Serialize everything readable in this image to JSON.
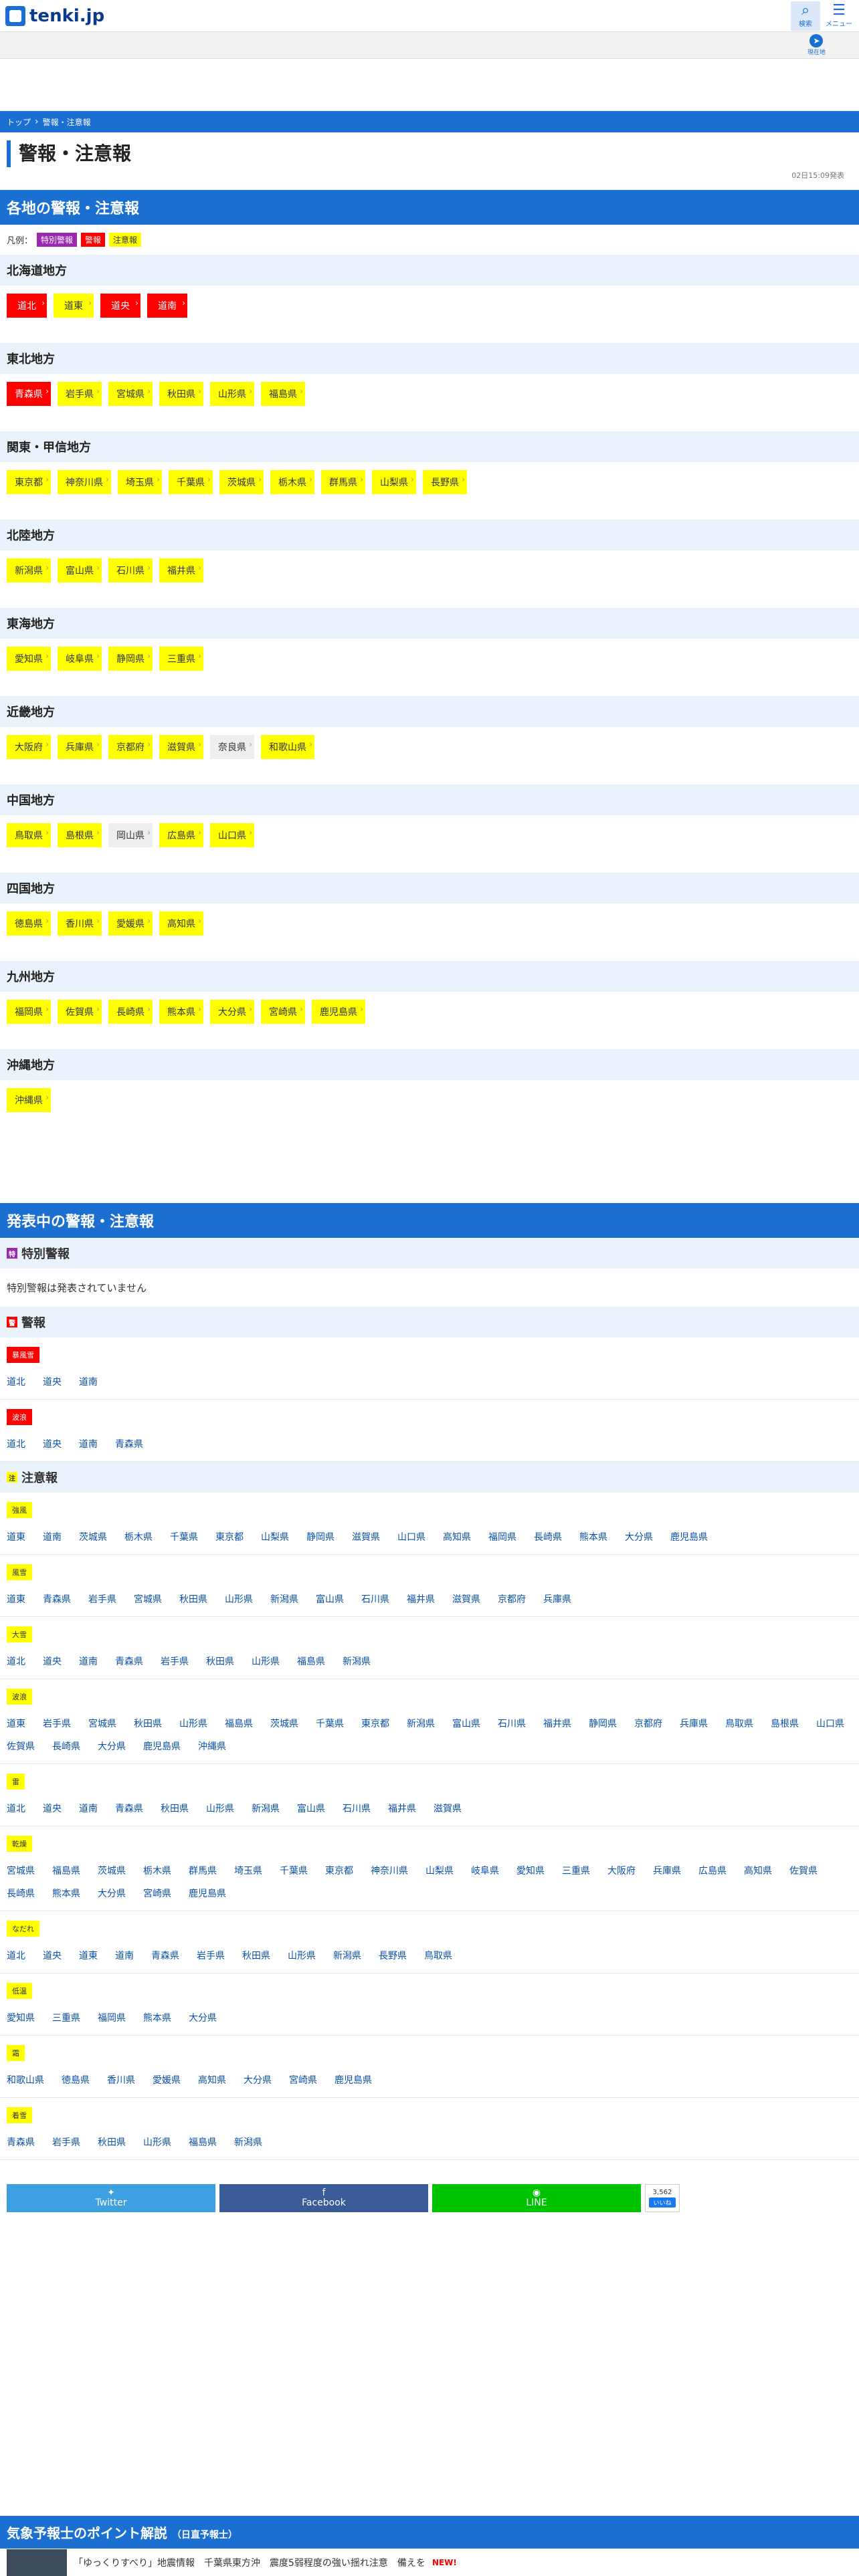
{
  "header": {
    "logo_text": "tenki.jp",
    "search_label": "検索",
    "menu_label": "メニュー",
    "location_label": "現在地"
  },
  "breadcrumb": [
    "トップ",
    "警報・注意報"
  ],
  "page_title": "警報・注意報",
  "issued_text": "02日15:09発表",
  "region_section_title": "各地の警報・注意報",
  "legend": {
    "label": "凡例：",
    "special": "特別警報",
    "warning": "警報",
    "advisory": "注意報"
  },
  "regions": [
    {
      "name": "北海道地方",
      "prefs": [
        {
          "name": "道北",
          "level": "red"
        },
        {
          "name": "道東",
          "level": "yellow"
        },
        {
          "name": "道央",
          "level": "red"
        },
        {
          "name": "道南",
          "level": "red"
        }
      ]
    },
    {
      "name": "東北地方",
      "prefs": [
        {
          "name": "青森県",
          "level": "red"
        },
        {
          "name": "岩手県",
          "level": "yellow"
        },
        {
          "name": "宮城県",
          "level": "yellow"
        },
        {
          "name": "秋田県",
          "level": "yellow"
        },
        {
          "name": "山形県",
          "level": "yellow"
        },
        {
          "name": "福島県",
          "level": "yellow"
        }
      ]
    },
    {
      "name": "関東・甲信地方",
      "prefs": [
        {
          "name": "東京都",
          "level": "yellow"
        },
        {
          "name": "神奈川県",
          "level": "yellow"
        },
        {
          "name": "埼玉県",
          "level": "yellow"
        },
        {
          "name": "千葉県",
          "level": "yellow"
        },
        {
          "name": "茨城県",
          "level": "yellow"
        },
        {
          "name": "栃木県",
          "level": "yellow"
        },
        {
          "name": "群馬県",
          "level": "yellow"
        },
        {
          "name": "山梨県",
          "level": "yellow"
        },
        {
          "name": "長野県",
          "level": "yellow"
        }
      ]
    },
    {
      "name": "北陸地方",
      "prefs": [
        {
          "name": "新潟県",
          "level": "yellow"
        },
        {
          "name": "富山県",
          "level": "yellow"
        },
        {
          "name": "石川県",
          "level": "yellow"
        },
        {
          "name": "福井県",
          "level": "yellow"
        }
      ]
    },
    {
      "name": "東海地方",
      "prefs": [
        {
          "name": "愛知県",
          "level": "yellow"
        },
        {
          "name": "岐阜県",
          "level": "yellow"
        },
        {
          "name": "静岡県",
          "level": "yellow"
        },
        {
          "name": "三重県",
          "level": "yellow"
        }
      ]
    },
    {
      "name": "近畿地方",
      "prefs": [
        {
          "name": "大阪府",
          "level": "yellow"
        },
        {
          "name": "兵庫県",
          "level": "yellow"
        },
        {
          "name": "京都府",
          "level": "yellow"
        },
        {
          "name": "滋賀県",
          "level": "yellow"
        },
        {
          "name": "奈良県",
          "level": "gray"
        },
        {
          "name": "和歌山県",
          "level": "yellow"
        }
      ]
    },
    {
      "name": "中国地方",
      "prefs": [
        {
          "name": "鳥取県",
          "level": "yellow"
        },
        {
          "name": "島根県",
          "level": "yellow"
        },
        {
          "name": "岡山県",
          "level": "gray"
        },
        {
          "name": "広島県",
          "level": "yellow"
        },
        {
          "name": "山口県",
          "level": "yellow"
        }
      ]
    },
    {
      "name": "四国地方",
      "prefs": [
        {
          "name": "徳島県",
          "level": "yellow"
        },
        {
          "name": "香川県",
          "level": "yellow"
        },
        {
          "name": "愛媛県",
          "level": "yellow"
        },
        {
          "name": "高知県",
          "level": "yellow"
        }
      ]
    },
    {
      "name": "九州地方",
      "prefs": [
        {
          "name": "福岡県",
          "level": "yellow"
        },
        {
          "name": "佐賀県",
          "level": "yellow"
        },
        {
          "name": "長崎県",
          "level": "yellow"
        },
        {
          "name": "熊本県",
          "level": "yellow"
        },
        {
          "name": "大分県",
          "level": "yellow"
        },
        {
          "name": "宮崎県",
          "level": "yellow"
        },
        {
          "name": "鹿児島県",
          "level": "yellow"
        }
      ]
    },
    {
      "name": "沖縄地方",
      "prefs": [
        {
          "name": "沖縄県",
          "level": "yellow"
        }
      ]
    }
  ],
  "issued_section_title": "発表中の警報・注意報",
  "special": {
    "title": "特別警報",
    "icon_text": "特",
    "none_text": "特別警報は発表されていません"
  },
  "warnings": {
    "title": "警報",
    "icon_text": "警",
    "types": [
      {
        "tag": "暴風雪",
        "areas": [
          "道北",
          "道央",
          "道南"
        ]
      },
      {
        "tag": "波浪",
        "areas": [
          "道北",
          "道央",
          "道南",
          "青森県"
        ]
      }
    ]
  },
  "advisories": {
    "title": "注意報",
    "icon_text": "注",
    "types": [
      {
        "tag": "強風",
        "areas": [
          "道東",
          "道南",
          "茨城県",
          "栃木県",
          "千葉県",
          "東京都",
          "山梨県",
          "静岡県",
          "滋賀県",
          "山口県",
          "高知県",
          "福岡県",
          "長崎県",
          "熊本県",
          "大分県",
          "鹿児島県"
        ]
      },
      {
        "tag": "風雪",
        "areas": [
          "道東",
          "青森県",
          "岩手県",
          "宮城県",
          "秋田県",
          "山形県",
          "新潟県",
          "富山県",
          "石川県",
          "福井県",
          "滋賀県",
          "京都府",
          "兵庫県"
        ]
      },
      {
        "tag": "大雪",
        "areas": [
          "道北",
          "道央",
          "道南",
          "青森県",
          "岩手県",
          "秋田県",
          "山形県",
          "福島県",
          "新潟県"
        ]
      },
      {
        "tag": "波浪",
        "areas": [
          "道東",
          "岩手県",
          "宮城県",
          "秋田県",
          "山形県",
          "福島県",
          "茨城県",
          "千葉県",
          "東京都",
          "新潟県",
          "富山県",
          "石川県",
          "福井県",
          "静岡県",
          "京都府",
          "兵庫県",
          "鳥取県",
          "島根県",
          "山口県",
          "佐賀県",
          "長崎県",
          "大分県",
          "鹿児島県",
          "沖縄県"
        ]
      },
      {
        "tag": "雷",
        "areas": [
          "道北",
          "道央",
          "道南",
          "青森県",
          "秋田県",
          "山形県",
          "新潟県",
          "富山県",
          "石川県",
          "福井県",
          "滋賀県"
        ]
      },
      {
        "tag": "乾燥",
        "areas": [
          "宮城県",
          "福島県",
          "茨城県",
          "栃木県",
          "群馬県",
          "埼玉県",
          "千葉県",
          "東京都",
          "神奈川県",
          "山梨県",
          "岐阜県",
          "愛知県",
          "三重県",
          "大阪府",
          "兵庫県",
          "広島県",
          "高知県",
          "佐賀県",
          "長崎県",
          "熊本県",
          "大分県",
          "宮崎県",
          "鹿児島県"
        ]
      },
      {
        "tag": "なだれ",
        "areas": [
          "道北",
          "道央",
          "道東",
          "道南",
          "青森県",
          "岩手県",
          "秋田県",
          "山形県",
          "新潟県",
          "長野県",
          "鳥取県"
        ]
      },
      {
        "tag": "低温",
        "areas": [
          "愛知県",
          "三重県",
          "福岡県",
          "熊本県",
          "大分県"
        ]
      },
      {
        "tag": "霜",
        "areas": [
          "和歌山県",
          "徳島県",
          "香川県",
          "愛媛県",
          "高知県",
          "大分県",
          "宮崎県",
          "鹿児島県"
        ]
      },
      {
        "tag": "着雪",
        "areas": [
          "青森県",
          "岩手県",
          "秋田県",
          "山形県",
          "福島県",
          "新潟県"
        ]
      }
    ]
  },
  "share": {
    "twitter": "Twitter",
    "facebook": "Facebook",
    "line": "LINE",
    "fb_count": "3,562",
    "fb_like": "いいね"
  },
  "pro_section": {
    "title": "気象予報士のポイント解説",
    "subtitle": "（日直予報士）",
    "news_title": "「ゆっくりすべり」地震情報　千葉県東方沖　震度5弱程度の強い揺れ注意　備えを",
    "new_badge": "NEW!"
  }
}
